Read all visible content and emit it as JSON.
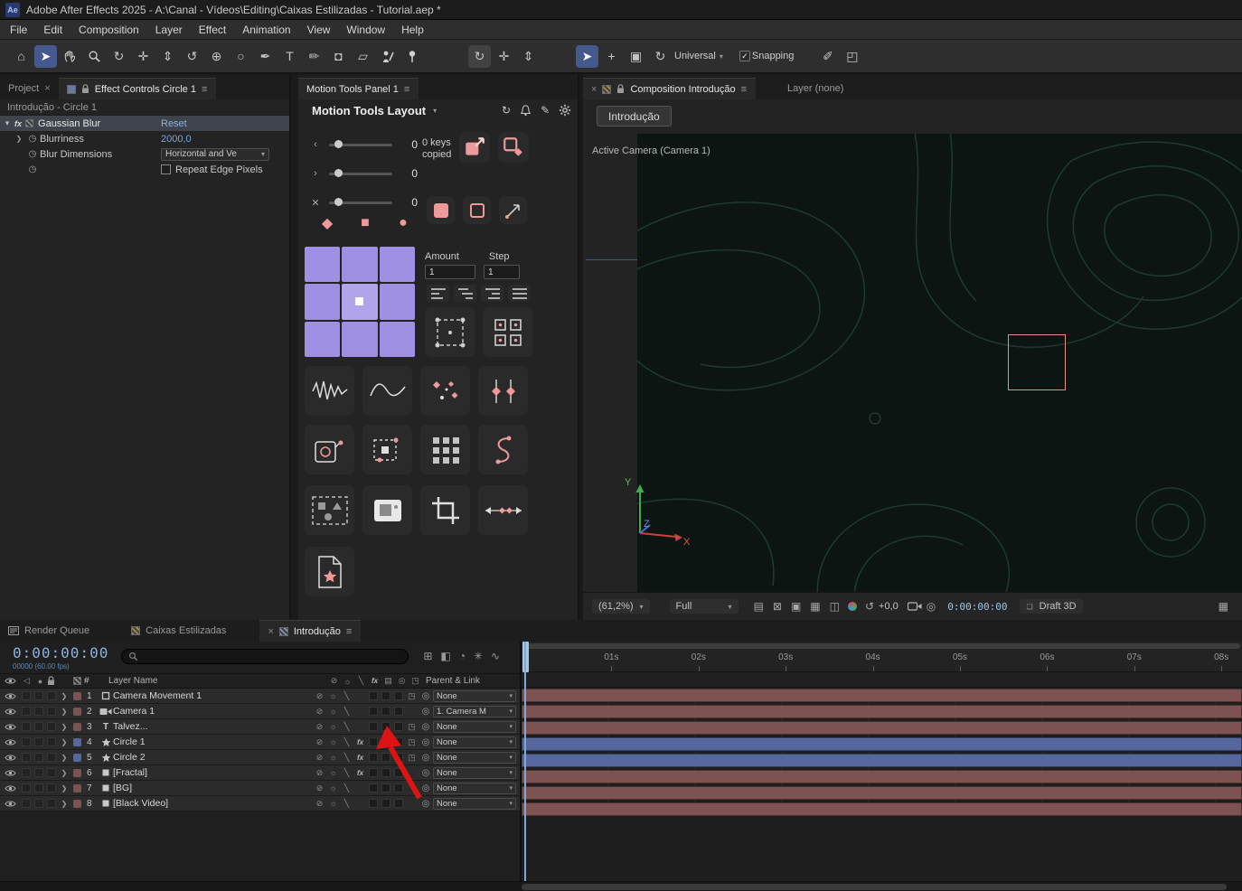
{
  "titlebar": {
    "app_badge": "Ae",
    "title": "Adobe After Effects 2025 - A:\\Canal - Vídeos\\Editing\\Caixas Estilizadas - Tutorial.aep *"
  },
  "menubar": {
    "items": [
      "File",
      "Edit",
      "Composition",
      "Layer",
      "Effect",
      "Animation",
      "View",
      "Window",
      "Help"
    ]
  },
  "toolbar": {
    "universal_label": "Universal",
    "snapping_label": "Snapping",
    "snapping_checked": true,
    "tools": [
      {
        "name": "home-icon",
        "glyph": "⌂"
      },
      {
        "name": "selection-tool-icon",
        "glyph": "➤",
        "state": "sel"
      },
      {
        "name": "hand-tool-icon",
        "svg": "hand-icon"
      },
      {
        "name": "zoom-tool-icon",
        "svg": "zoom-icon"
      },
      {
        "name": "orbit-camera-tool-icon",
        "glyph": "↻"
      },
      {
        "name": "track-xy-camera-tool-icon",
        "glyph": "✛"
      },
      {
        "name": "dolly-camera-tool-icon",
        "glyph": "⇕"
      },
      {
        "name": "rotation-tool-icon",
        "glyph": "↺"
      },
      {
        "name": "pan-behind-tool-icon",
        "glyph": "⊕"
      },
      {
        "name": "shape-tool-icon",
        "glyph": "○"
      },
      {
        "name": "pen-tool-icon",
        "glyph": "✒"
      },
      {
        "name": "type-tool-icon",
        "glyph": "T"
      },
      {
        "name": "brush-tool-icon",
        "glyph": "✏"
      },
      {
        "name": "clone-stamp-tool-icon",
        "glyph": "◘"
      },
      {
        "name": "eraser-tool-icon",
        "glyph": "▱"
      },
      {
        "name": "roto-brush-tool-icon",
        "svg": "roto-icon"
      },
      {
        "name": "puppet-pin-tool-icon",
        "svg": "pin-icon"
      }
    ],
    "camera_tools": [
      {
        "name": "orbit-around-cursor-tool-icon",
        "glyph": "↻",
        "state": "sel2"
      },
      {
        "name": "pan-under-cursor-tool-icon",
        "glyph": "✛"
      },
      {
        "name": "dolly-toward-cursor-tool-icon",
        "glyph": "⇕"
      }
    ],
    "universal_tools": [
      {
        "name": "universal-selection-icon",
        "glyph": "➤",
        "state": "sel"
      },
      {
        "name": "universal-add-icon",
        "glyph": "+"
      },
      {
        "name": "universal-bounding-box-icon",
        "glyph": "▣"
      },
      {
        "name": "universal-rotate-icon",
        "glyph": "↻"
      }
    ],
    "extra_tools": [
      {
        "name": "draw-path-icon",
        "glyph": "✐"
      },
      {
        "name": "expand-region-icon",
        "glyph": "◰"
      }
    ]
  },
  "effect_controls": {
    "tab_project": "Project",
    "tab_title": "Effect Controls Circle 1",
    "subtitle": "Introdução - Circle 1",
    "effect": {
      "badge": "fx",
      "name": "Gaussian Blur",
      "reset": "Reset",
      "rows": [
        {
          "label": "Blurriness",
          "value": "2000,0"
        },
        {
          "label": "Blur Dimensions",
          "value": "Horizontal and Ve"
        },
        {
          "label": "Repeat Edge Pixels",
          "value": ""
        }
      ]
    }
  },
  "motion_panel": {
    "tab_title": "Motion Tools Panel 1",
    "layout_title": "Motion Tools Layout",
    "sliders": [
      {
        "value": "0"
      },
      {
        "value": "0"
      },
      {
        "value": "0"
      }
    ],
    "keys_copied": "0 keys copied",
    "amount_label": "Amount",
    "amount_value": "1",
    "step_label": "Step",
    "step_value": "1",
    "tiles_keys": [
      "copy-keys-icon",
      "paste-keys-icon"
    ],
    "shape_row": [
      "diamond-shape-icon",
      "square-shape-icon",
      "circle-shape-icon"
    ],
    "tiles_small": [
      "filled-square-icon",
      "outlined-square-icon",
      "diagonal-arrow-icon"
    ],
    "align_tiles": [
      "align-left-icon",
      "align-stagger-icon",
      "align-right-icon",
      "align-justify-icon"
    ],
    "tiles_mid": [
      "selection-region-icon",
      "distribute-boxes-icon"
    ],
    "tiles_row4": [
      "noise-wave-icon",
      "smooth-wave-icon",
      "scatter-diamonds-icon",
      "keyframe-pins-icon"
    ],
    "tiles_row5": [
      "shape-target-icon",
      "bounding-dots-icon",
      "grid-dots-icon",
      "s-curve-icon"
    ],
    "tiles_row6": [
      "marquee-shapes-icon",
      "snapshot-icon",
      "crop-icon",
      "spacing-arrows-icon"
    ],
    "tiles_row7": [
      "new-doc-star-icon"
    ]
  },
  "composition": {
    "tab_title": "Composition Introdução",
    "tab_layer": "Layer (none)",
    "comp_chip": "Introdução",
    "camera_label": "Active Camera (Camera 1)",
    "axis": {
      "x": "X",
      "y": "Y",
      "z": "Z"
    },
    "footer": {
      "zoom": "(61,2%)",
      "resolution": "Full",
      "exposure": "+0,0",
      "timecode": "0:00:00:00",
      "renderer": "Draft 3D"
    }
  },
  "timeline": {
    "tabs": [
      {
        "label": "Render Queue"
      },
      {
        "label": "Caixas Estilizadas"
      },
      {
        "label": "Introdução",
        "active": true
      }
    ],
    "timecode": "0:00:00:00",
    "frame_info": "00000 (60.00 fps)",
    "columns": {
      "layer_name": "Layer Name",
      "parent_link": "Parent & Link",
      "hash": "#"
    },
    "ruler_labels": [
      "01s",
      "02s",
      "03s",
      "04s",
      "05s",
      "06s",
      "07s",
      "08s"
    ],
    "layers": [
      {
        "num": "1",
        "icon": "null",
        "name": "Camera Movement 1",
        "parent": "None",
        "bar": "red",
        "cube": true
      },
      {
        "num": "2",
        "icon": "camera",
        "name": "Camera 1",
        "parent": "1. Camera M",
        "bar": "red",
        "cube": false
      },
      {
        "num": "3",
        "icon": "text",
        "name": "Talvez...",
        "parent": "None",
        "bar": "red",
        "cube": true
      },
      {
        "num": "4",
        "icon": "star",
        "name": "Circle 1",
        "parent": "None",
        "bar": "blue",
        "fx": true,
        "cube": true
      },
      {
        "num": "5",
        "icon": "star",
        "name": "Circle 2",
        "parent": "None",
        "bar": "blue",
        "fx": true,
        "cube": true
      },
      {
        "num": "6",
        "icon": "solid",
        "name": "[Fractal]",
        "parent": "None",
        "bar": "red",
        "fx": true,
        "cube": false
      },
      {
        "num": "7",
        "icon": "solid",
        "name": "[BG]",
        "parent": "None",
        "bar": "red",
        "cube": false
      },
      {
        "num": "8",
        "icon": "solid",
        "name": "[Black Video]",
        "parent": "None",
        "bar": "red",
        "cube": false
      }
    ]
  },
  "colors": {
    "accent_value": "#76a9dd",
    "salmon": "#ef9a9a",
    "purple": "#a18fe3",
    "bar_red": "#7d5252",
    "bar_blue": "#55679c",
    "arrow_red": "#de1414"
  }
}
